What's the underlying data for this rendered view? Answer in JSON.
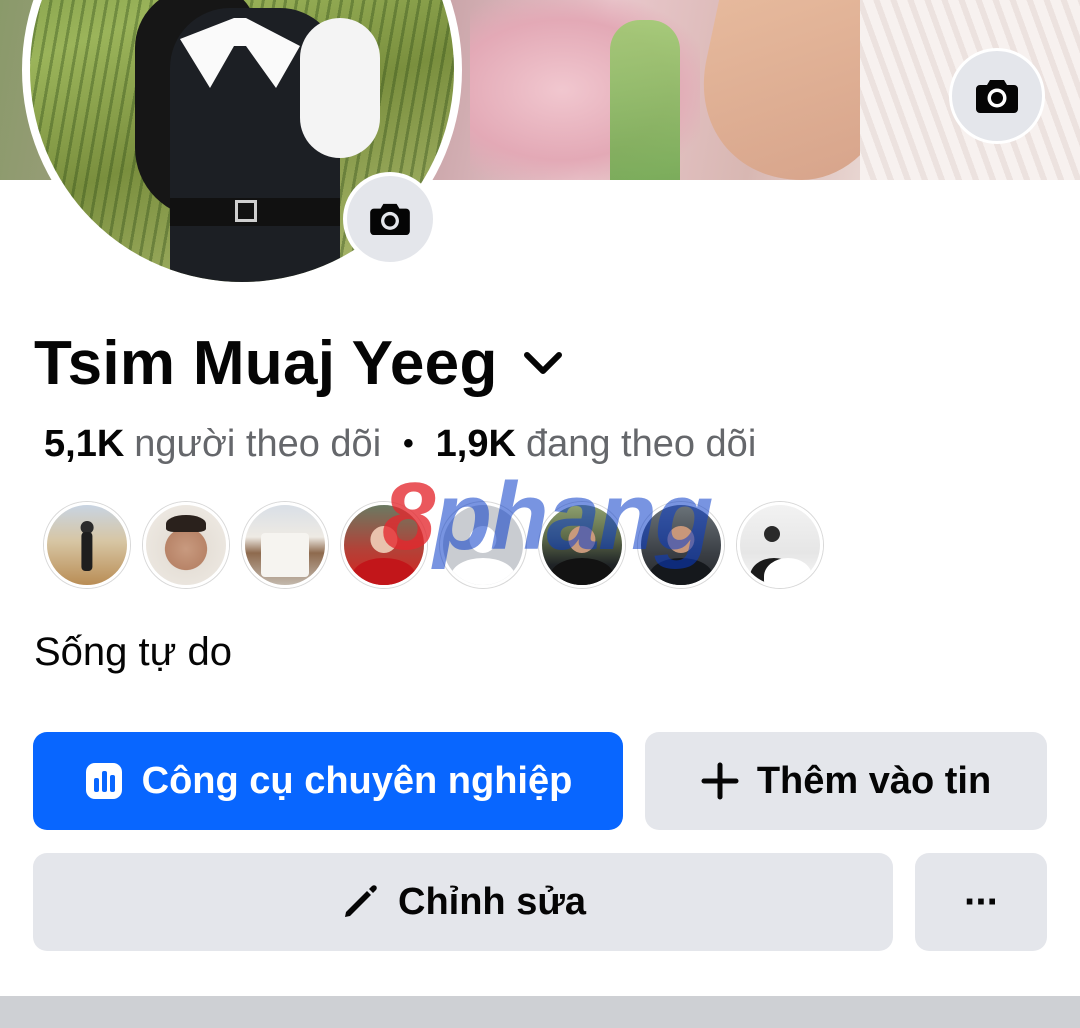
{
  "profile": {
    "name": "Tsim Muaj Yeeg",
    "bio": "Sống tự do"
  },
  "stats": {
    "followers_count": "5,1K",
    "followers_label": "người theo dõi",
    "separator": "•",
    "following_count": "1,9K",
    "following_label": "đang theo dõi"
  },
  "friends": [
    {
      "icon": "friend-avatar-1"
    },
    {
      "icon": "friend-avatar-2"
    },
    {
      "icon": "friend-avatar-3"
    },
    {
      "icon": "friend-avatar-4"
    },
    {
      "icon": "default-avatar-icon"
    },
    {
      "icon": "friend-avatar-6"
    },
    {
      "icon": "friend-avatar-7"
    },
    {
      "icon": "friend-avatar-8"
    }
  ],
  "watermark": {
    "text_1": "8",
    "text_2": "phang"
  },
  "buttons": {
    "professional_dashboard": "Công cụ chuyên nghiệp",
    "add_to_story": "Thêm vào tin",
    "edit": "Chỉnh sửa",
    "more": "···"
  },
  "icons": {
    "cover_camera": "camera-icon",
    "avatar_camera": "camera-icon",
    "name_dropdown": "chevron-down-icon",
    "pro_tools": "bar-chart-icon",
    "add_story": "plus-icon",
    "edit": "pencil-icon"
  },
  "colors": {
    "primary_blue": "#0866ff",
    "secondary_button": "#e4e6eb",
    "secondary_text": "#65676b"
  }
}
